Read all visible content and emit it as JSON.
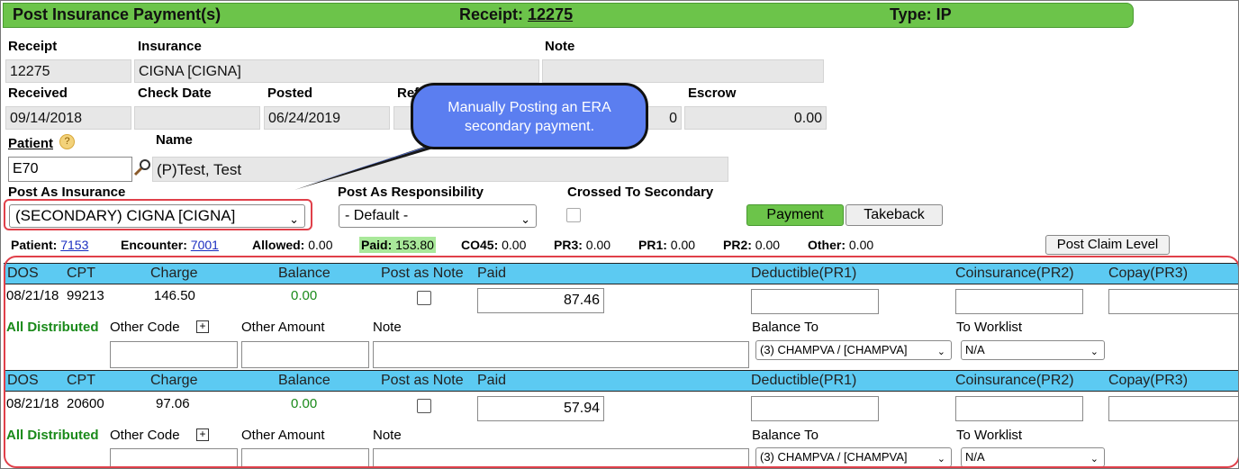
{
  "header": {
    "title": "Post Insurance Payment(s)",
    "receipt_label": "Receipt:",
    "receipt_no": "12275",
    "type": "Type: IP"
  },
  "fields": {
    "receipt_label": "Receipt",
    "receipt_value": "12275",
    "insurance_label": "Insurance",
    "insurance_value": "CIGNA [CIGNA]",
    "note_label": "Note",
    "note_value": "",
    "received_label": "Received",
    "received_value": "09/14/2018",
    "check_date_label": "Check Date",
    "check_date_value": "",
    "posted_label": "Posted",
    "posted_value": "06/24/2019",
    "ref_label": "Ref",
    "ref_value": "",
    "amount_tail": "0",
    "escrow_label": "Escrow",
    "escrow_value": "0.00",
    "patient_label": "Patient",
    "patient_id": "E70",
    "name_label": "Name",
    "name_value": "(P)Test, Test",
    "post_as_ins_label": "Post As Insurance",
    "post_as_ins_value": "(SECONDARY) CIGNA [CIGNA]",
    "post_as_resp_label": "Post As Responsibility",
    "post_as_resp_value": "- Default -",
    "crossed_label": "Crossed To Secondary"
  },
  "callout": "Manually Posting an ERA secondary payment.",
  "mode_buttons": {
    "payment": "Payment",
    "takeback": "Takeback"
  },
  "summary": {
    "patient_label": "Patient:",
    "patient_value": "7153",
    "encounter_label": "Encounter:",
    "encounter_value": "7001",
    "allowed_label": "Allowed:",
    "allowed_value": "0.00",
    "paid_label": "Paid:",
    "paid_value": "153.80",
    "co45_label": "CO45:",
    "co45_value": "0.00",
    "pr3_label": "PR3:",
    "pr3_value": "0.00",
    "pr1_label": "PR1:",
    "pr1_value": "0.00",
    "pr2_label": "PR2:",
    "pr2_value": "0.00",
    "other_label": "Other:",
    "other_value": "0.00",
    "post_claim_button": "Post Claim Level"
  },
  "columns": {
    "dos": "DOS",
    "cpt": "CPT",
    "charge": "Charge",
    "balance": "Balance",
    "post_as_note": "Post as Note",
    "paid": "Paid",
    "deductible": "Deductible(PR1)",
    "coinsurance": "Coinsurance(PR2)",
    "copay": "Copay(PR3)"
  },
  "sub_labels": {
    "all_distributed": "All Distributed",
    "other_code": "Other Code",
    "other_amount": "Other Amount",
    "note": "Note",
    "balance_to": "Balance To",
    "to_worklist": "To Worklist"
  },
  "lines": [
    {
      "dos": "08/21/18",
      "cpt": "99213",
      "charge": "146.50",
      "balance": "0.00",
      "paid": "87.46",
      "balance_to": "(3) CHAMPVA / [CHAMPVA]",
      "worklist": "N/A"
    },
    {
      "dos": "08/21/18",
      "cpt": "20600",
      "charge": "97.06",
      "balance": "0.00",
      "paid": "57.94",
      "balance_to": "(3) CHAMPVA / [CHAMPVA]",
      "worklist": "N/A"
    }
  ],
  "colors": {
    "header_green": "#6cc44a",
    "table_blue": "#5ccaf2",
    "highlight_red": "#e0404a",
    "callout_blue": "#5b7ef0",
    "link_blue": "#1a2ec0",
    "balance_green": "#1a8a1a"
  }
}
